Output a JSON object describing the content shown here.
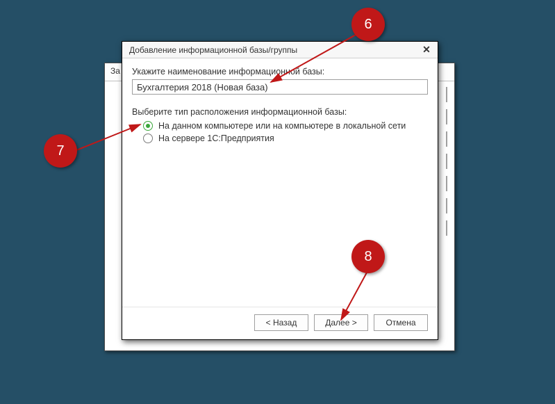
{
  "back_window": {
    "title_fragment": "За"
  },
  "dialog": {
    "title": "Добавление информационной базы/группы",
    "label_name": "Укажите наименование информационной базы:",
    "input_value": "Бухгалтерия 2018 (Новая база)",
    "label_location": "Выберите тип расположения информационной базы:",
    "radio": {
      "local": "На данном компьютере или на компьютере в локальной сети",
      "server": "На сервере 1С:Предприятия"
    },
    "buttons": {
      "back": "< Назад",
      "next": "Далее >",
      "cancel": "Отмена"
    }
  },
  "annotations": {
    "b6": "6",
    "b7": "7",
    "b8": "8"
  }
}
